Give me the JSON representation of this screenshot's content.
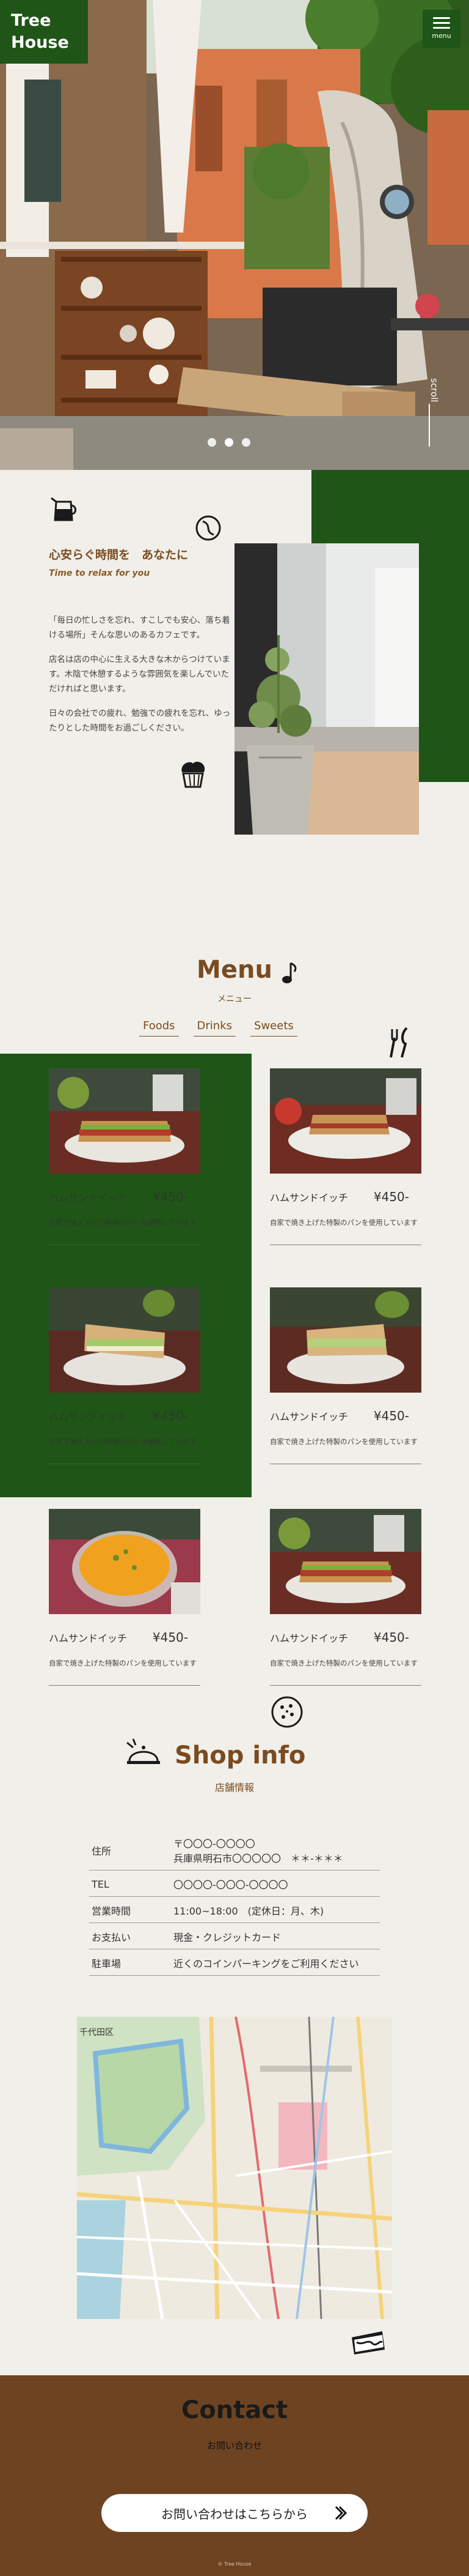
{
  "header": {
    "logo_line1": "Tree",
    "logo_line2": "House",
    "menu_label": "menu",
    "scroll_label": "scroll"
  },
  "about": {
    "heading_ja": "心安らぐ時間を　あなたに",
    "heading_en": "Time to relax for you",
    "paragraphs": [
      "「毎日の忙しさを忘れ、すこしでも安心、落ち着ける場所」そんな思いのあるカフェです。",
      "店名は店の中心に生える大きな木からつけています。木陰で休憩するような雰囲気を楽しんでいただければと思います。",
      "日々の会社での疲れ、勉強での疲れを忘れ、ゆったりとした時間をお過ごしください。"
    ]
  },
  "menu": {
    "title": "Menu",
    "subtitle": "メニュー",
    "tabs": [
      "Foods",
      "Drinks",
      "Sweets"
    ],
    "items": [
      {
        "name": "ハムサンドイッチ",
        "price": "¥450-",
        "desc": "自家で焼き上げた特製のパンを使用しています"
      },
      {
        "name": "ハムサンドイッチ",
        "price": "¥450-",
        "desc": "自家で焼き上げた特製のパンを使用しています"
      },
      {
        "name": "ハムサンドイッチ",
        "price": "¥450-",
        "desc": "自家で焼き上げた特製のパンを使用しています"
      },
      {
        "name": "ハムサンドイッチ",
        "price": "¥450-",
        "desc": "自家で焼き上げた特製のパンを使用しています"
      },
      {
        "name": "ハムサンドイッチ",
        "price": "¥450-",
        "desc": "自家で焼き上げた特製のパンを使用しています"
      },
      {
        "name": "ハムサンドイッチ",
        "price": "¥450-",
        "desc": "自家で焼き上げた特製のパンを使用しています"
      }
    ]
  },
  "shop": {
    "title": "Shop info",
    "subtitle": "店舗情報",
    "rows": [
      {
        "label": "住所",
        "value_line1": "〒〇〇〇-〇〇〇〇",
        "value_line2": "兵庫県明石市〇〇〇〇〇　＊＊-＊＊＊"
      },
      {
        "label": "TEL",
        "value_line1": "〇〇〇〇-〇〇〇-〇〇〇〇"
      },
      {
        "label": "営業時間",
        "value_line1": "11:00~18:00　(定休日：月、木)"
      },
      {
        "label": "お支払い",
        "value_line1": "現金・クレジットカード"
      },
      {
        "label": "駐車場",
        "value_line1": "近くのコインパーキングをご利用ください"
      }
    ],
    "map_label": "千代田区"
  },
  "contact": {
    "title": "Contact",
    "subtitle": "お問い合わせ",
    "button_label": "お問い合わせはこちらから",
    "copyright": "© Tree House"
  },
  "colors": {
    "green": "#1f5517",
    "brown": "#7a4b20",
    "contact_bg": "#6e4321",
    "page_bg": "#f1efe9"
  },
  "icons": [
    "coffee-pot-icon",
    "coffee-bean-icon",
    "muffin-icon",
    "music-note-icon",
    "fork-knife-icon",
    "cookie-icon",
    "cloche-icon",
    "cake-icon",
    "chevron-right-icon"
  ]
}
